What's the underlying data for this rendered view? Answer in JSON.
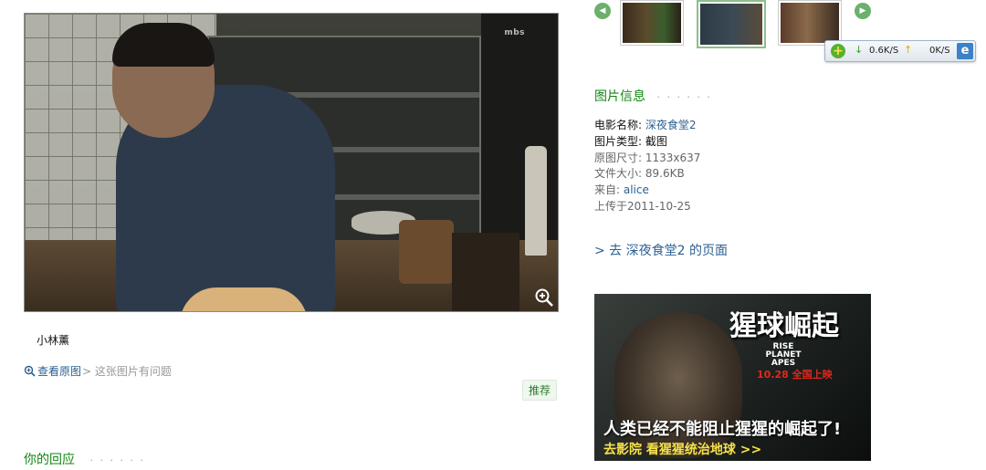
{
  "photo": {
    "watermark": "mbs",
    "zoom_icon": "zoom-in-icon"
  },
  "caption": "小林薰",
  "links": {
    "view_original": "查看原图",
    "report": "> 这张图片有问题",
    "recommend": "推荐"
  },
  "reply": {
    "title": "你的回应",
    "dots": "· · · · · ·"
  },
  "thumbnails": {
    "prev_icon": "arrow-left-icon",
    "next_icon": "arrow-right-icon",
    "selected_index": 1
  },
  "net_widget": {
    "down_speed": "0.6K/S",
    "up_speed": "0K/S",
    "icons": [
      "plus-icon",
      "down-arrow-icon",
      "up-arrow-icon",
      "ie-icon"
    ]
  },
  "info": {
    "title": "图片信息",
    "dots": "· · · · · ·",
    "movie_label": "电影名称: ",
    "movie_value": "深夜食堂2",
    "type_label": "图片类型: ",
    "type_value": "截图",
    "size_label": "原图尺寸: ",
    "size_value": "1133x637",
    "filesize_label": "文件大小: ",
    "filesize_value": "89.6KB",
    "from_label": "来自: ",
    "from_value": "alice",
    "uploaded": "上传于2011-10-25",
    "goto": "> 去 深夜食堂2 的页面"
  },
  "ad": {
    "title": "猩球崛起",
    "subtitle": "RISE PLANET APES",
    "date": "10.28 全国上映",
    "tagline": "人类已经不能阻止猩猩的崛起了!",
    "cta": "去影院 看猩猩统治地球 >>"
  },
  "colors": {
    "green_heading": "#138613",
    "link_blue": "#2a5f91",
    "ad_red": "#e3271c",
    "ad_yellow": "#f7e14a"
  }
}
